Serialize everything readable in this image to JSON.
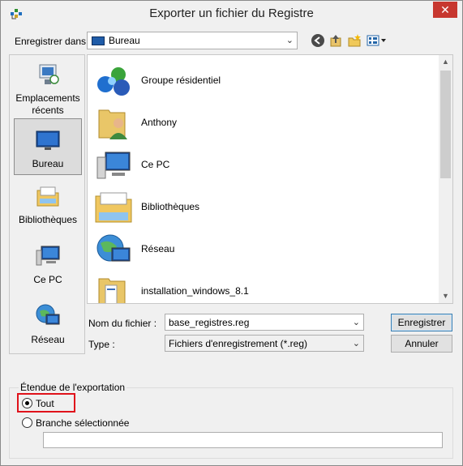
{
  "window": {
    "title": "Exporter un fichier du Registre",
    "close_glyph": "✕"
  },
  "toolbar": {
    "save_in_label": "Enregistrer dans :",
    "save_in_value": "Bureau",
    "icons": [
      "back-icon",
      "up-folder-icon",
      "new-folder-icon",
      "view-menu-icon"
    ]
  },
  "places": [
    {
      "label": "Emplacements récents",
      "icon": "recent-places-icon",
      "selected": false
    },
    {
      "label": "Bureau",
      "icon": "desktop-icon",
      "selected": true
    },
    {
      "label": "Bibliothèques",
      "icon": "libraries-icon",
      "selected": false
    },
    {
      "label": "Ce PC",
      "icon": "this-pc-icon",
      "selected": false
    },
    {
      "label": "Réseau",
      "icon": "network-icon",
      "selected": false
    }
  ],
  "files": [
    {
      "name": "Groupe résidentiel",
      "icon": "homegroup-icon"
    },
    {
      "name": "Anthony",
      "icon": "user-folder-icon"
    },
    {
      "name": "Ce PC",
      "icon": "this-pc-icon"
    },
    {
      "name": "Bibliothèques",
      "icon": "libraries-icon"
    },
    {
      "name": "Réseau",
      "icon": "network-icon"
    },
    {
      "name": "installation_windows_8.1",
      "icon": "folder-icon"
    }
  ],
  "filename": {
    "label": "Nom du fichier :",
    "value": "base_registres.reg"
  },
  "filetype": {
    "label": "Type :",
    "value": "Fichiers d'enregistrement (*.reg)"
  },
  "buttons": {
    "save": "Enregistrer",
    "cancel": "Annuler"
  },
  "export_range": {
    "title": "Étendue de l'exportation",
    "option_all": "Tout",
    "option_branch": "Branche sélectionnée",
    "selected": "all",
    "branch_value": ""
  },
  "colors": {
    "highlight": "#e0121b",
    "accent": "#1f5ca8"
  }
}
